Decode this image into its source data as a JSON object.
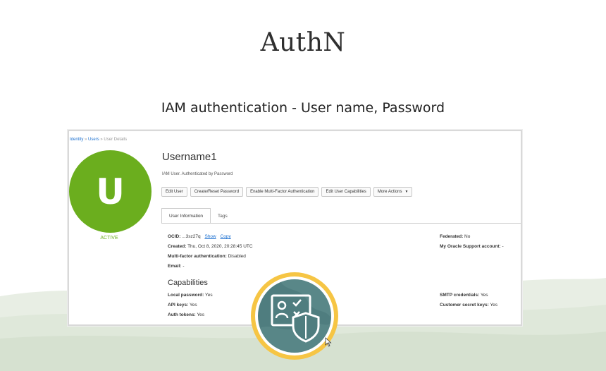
{
  "slide": {
    "title": "AuthN",
    "subtitle": "IAM authentication - User name, Password"
  },
  "console": {
    "breadcrumb": {
      "identity": "Identity",
      "sep1": "»",
      "users": "Users",
      "sep2": "»",
      "current": "User Details"
    },
    "avatar_letter": "U",
    "status": "ACTIVE",
    "username": "Username1",
    "description": "IAM User. Authenticated by Password",
    "buttons": {
      "edit_user": "Edit User",
      "reset_password": "Create/Reset Password",
      "enable_mfa": "Enable Multi-Factor Authentication",
      "edit_capabilities": "Edit User Capabilities",
      "more_actions": "More Actions"
    },
    "tabs": {
      "user_info": "User Information",
      "tags": "Tags"
    },
    "details": {
      "ocid_label": "OCID:",
      "ocid_value": "...3sz27q",
      "show": "Show",
      "copy": "Copy",
      "created_label": "Created:",
      "created_value": "Thu, Oct 8, 2020, 20:28:45 UTC",
      "mfa_label": "Multi-factor authentication:",
      "mfa_value": "Disabled",
      "email_label": "Email:",
      "email_value": "-",
      "federated_label": "Federated:",
      "federated_value": "No",
      "support_label": "My Oracle Support account:",
      "support_value": "-"
    },
    "capabilities": {
      "heading": "Capabilities",
      "local_password_label": "Local password:",
      "local_password_value": "Yes",
      "api_keys_label": "API keys:",
      "api_keys_value": "Yes",
      "auth_tokens_label": "Auth tokens:",
      "auth_tokens_value": "Yes",
      "smtp_label": "SMTP credentials:",
      "smtp_value": "Yes",
      "secret_keys_label": "Customer secret keys:",
      "secret_keys_value": "Yes"
    }
  },
  "badge_icon": "user-id-card-shield-icon",
  "colors": {
    "avatar": "#6bae1e",
    "badge_ring": "#f6c544",
    "badge_core": "#4f7d7f",
    "link": "#1a6fd0"
  }
}
